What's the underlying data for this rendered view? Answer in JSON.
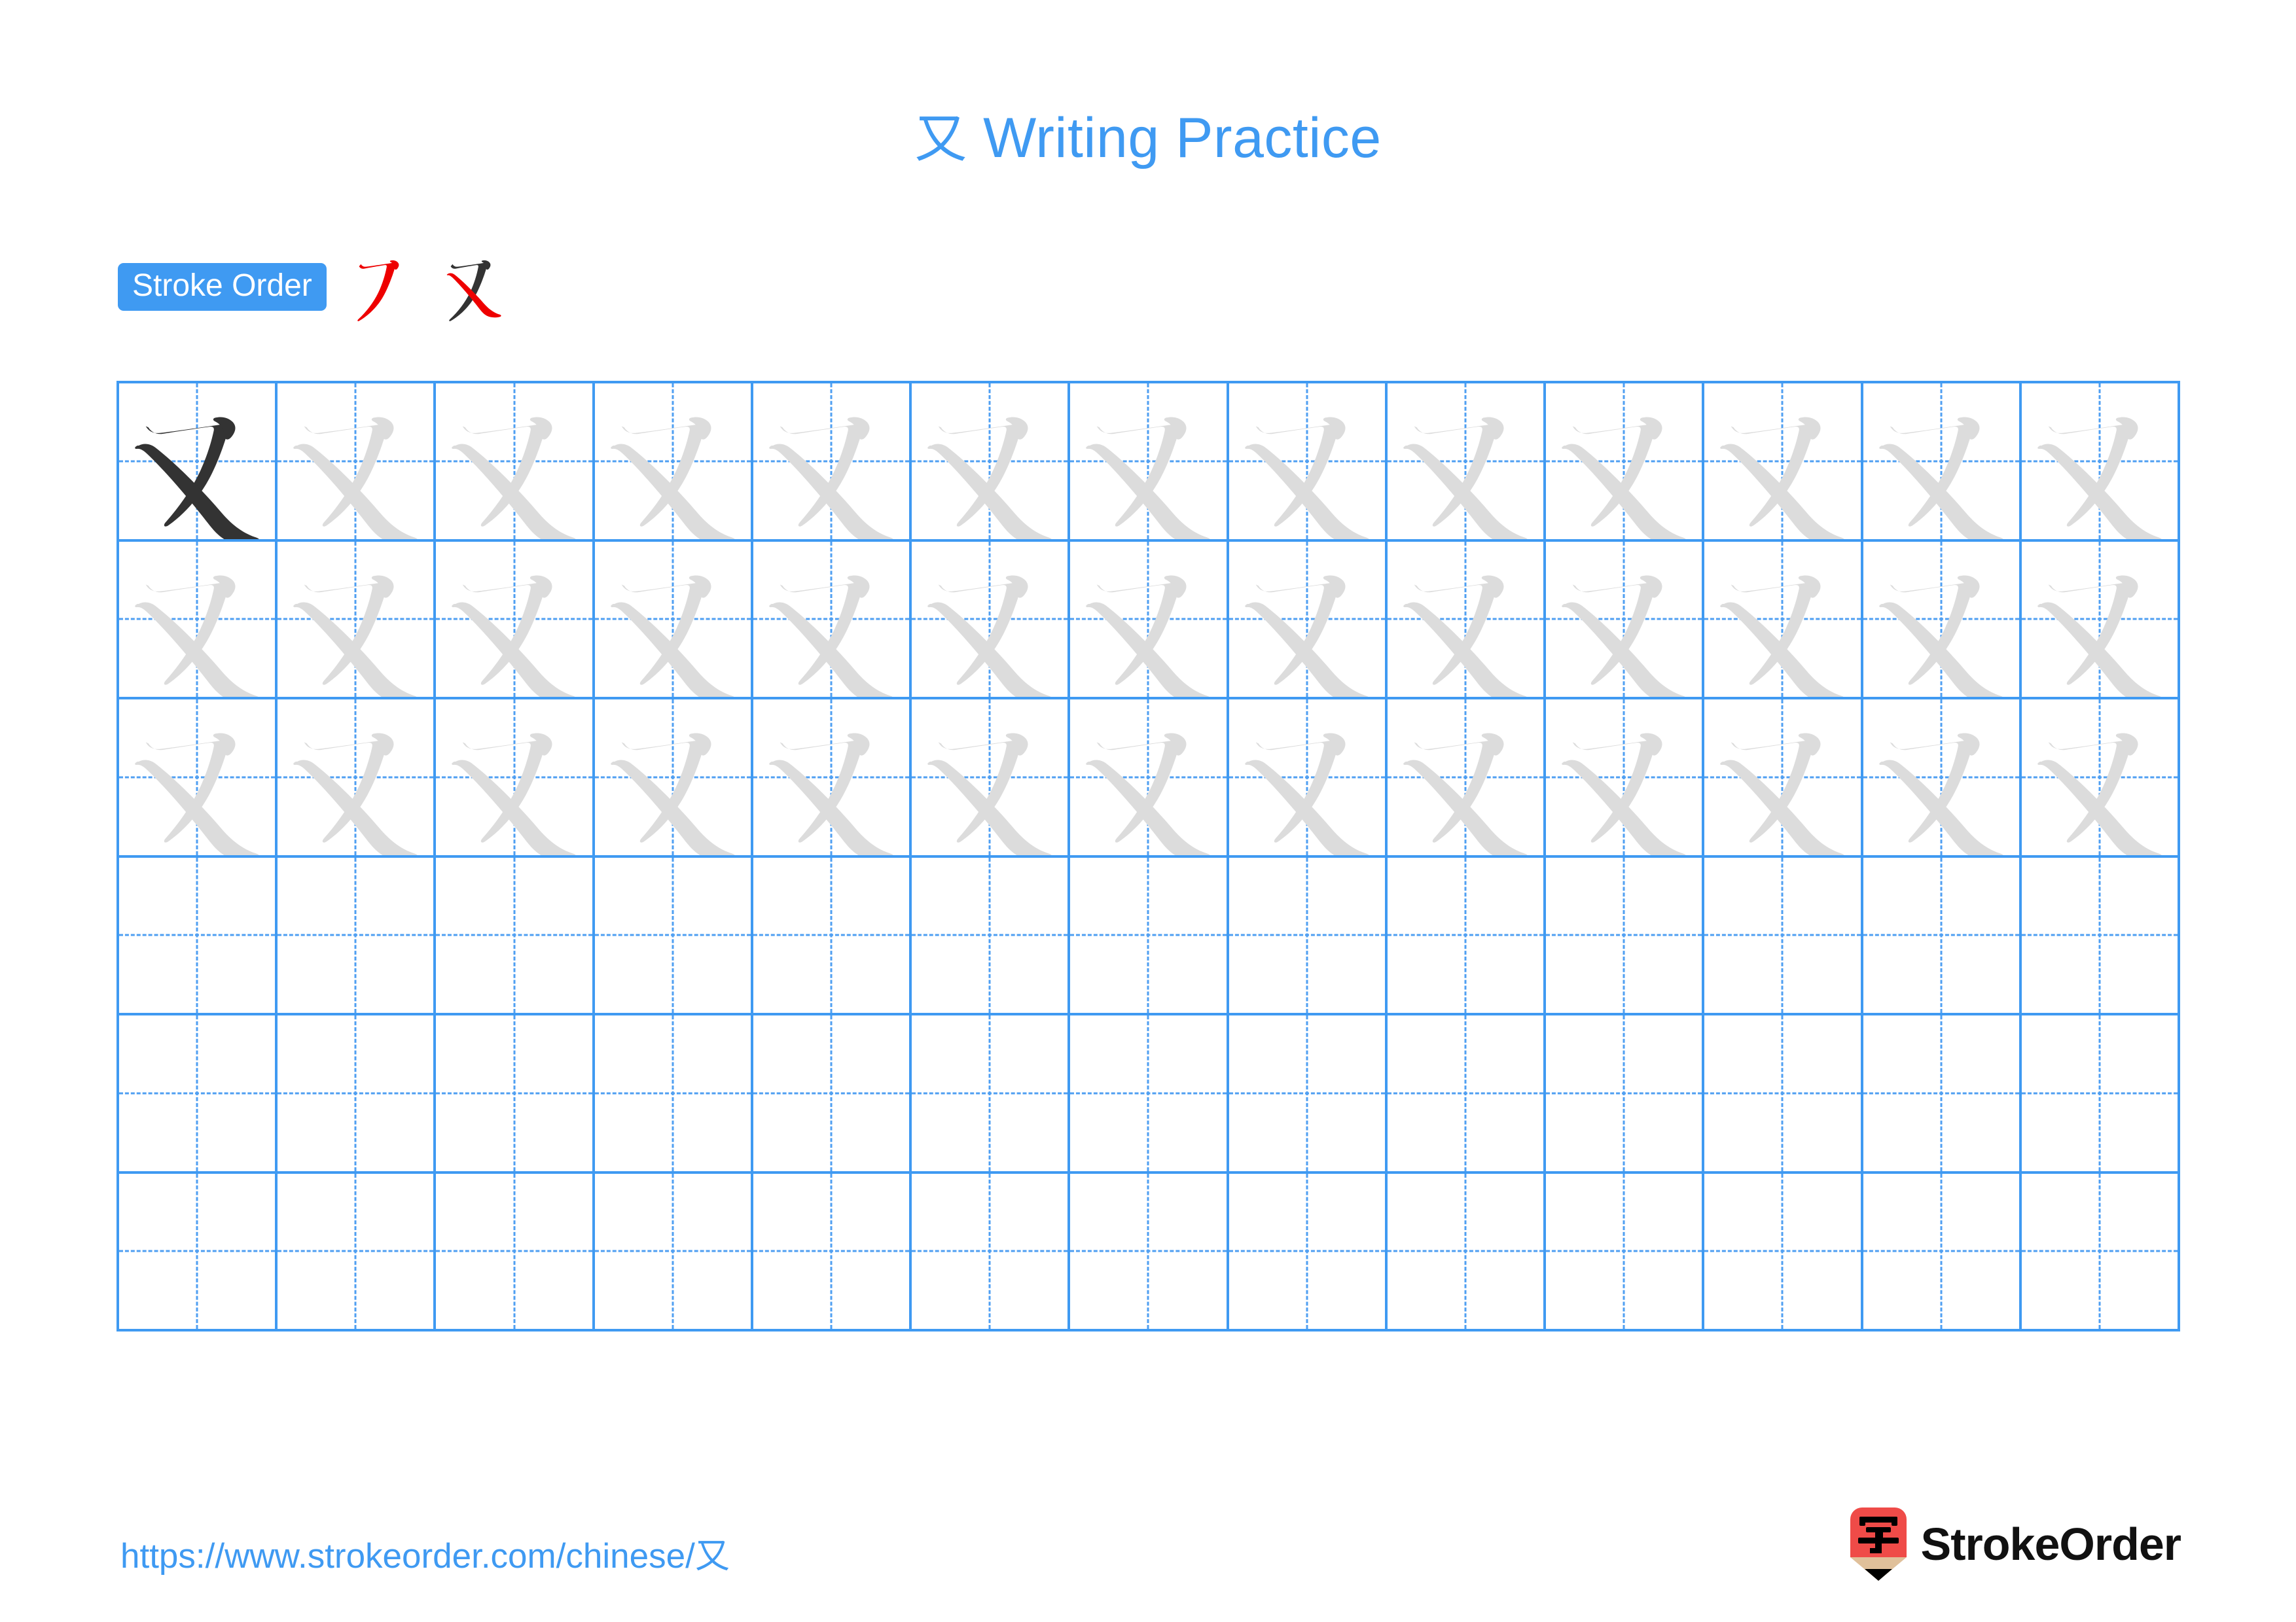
{
  "page": {
    "title_character": "又",
    "title_suffix": "Writing Practice",
    "background_color": "#ffffff"
  },
  "stroke_order": {
    "badge_label": "Stroke Order",
    "badge_bg_color": "#3f9af2",
    "badge_text_color": "#ffffff",
    "total_strokes": 2,
    "active_stroke_color": "#ee0000",
    "done_stroke_color": "#333333",
    "steps": [
      {
        "step": 1,
        "new_stroke_name": "heng-pie",
        "strokes_shown": 1
      },
      {
        "step": 2,
        "new_stroke_name": "na",
        "strokes_shown": 2
      }
    ]
  },
  "grid": {
    "character": "又",
    "columns": 13,
    "rows": 6,
    "line_color": "#3f9af2",
    "guide_line_color": "#4f9ff2",
    "model_glyph_color": "#333333",
    "trace_glyph_color": "#dcdcdc",
    "filled_rows": 3,
    "empty_rows": 3,
    "rows_data": [
      [
        "model",
        "trace",
        "trace",
        "trace",
        "trace",
        "trace",
        "trace",
        "trace",
        "trace",
        "trace",
        "trace",
        "trace",
        "trace"
      ],
      [
        "trace",
        "trace",
        "trace",
        "trace",
        "trace",
        "trace",
        "trace",
        "trace",
        "trace",
        "trace",
        "trace",
        "trace",
        "trace"
      ],
      [
        "trace",
        "trace",
        "trace",
        "trace",
        "trace",
        "trace",
        "trace",
        "trace",
        "trace",
        "trace",
        "trace",
        "trace",
        "trace"
      ],
      [
        "empty",
        "empty",
        "empty",
        "empty",
        "empty",
        "empty",
        "empty",
        "empty",
        "empty",
        "empty",
        "empty",
        "empty",
        "empty"
      ],
      [
        "empty",
        "empty",
        "empty",
        "empty",
        "empty",
        "empty",
        "empty",
        "empty",
        "empty",
        "empty",
        "empty",
        "empty",
        "empty"
      ],
      [
        "empty",
        "empty",
        "empty",
        "empty",
        "empty",
        "empty",
        "empty",
        "empty",
        "empty",
        "empty",
        "empty",
        "empty",
        "empty"
      ]
    ]
  },
  "footer": {
    "url_prefix": "https://www.strokeorder.com/chinese/",
    "url_character": "又",
    "url_color": "#3f9af2",
    "brand_name": "StrokeOrder",
    "brand_icon_character": "字",
    "brand_icon_color": "#ef4b48",
    "brand_icon_wood_color": "#e0c09a",
    "brand_text_color": "#111111"
  }
}
